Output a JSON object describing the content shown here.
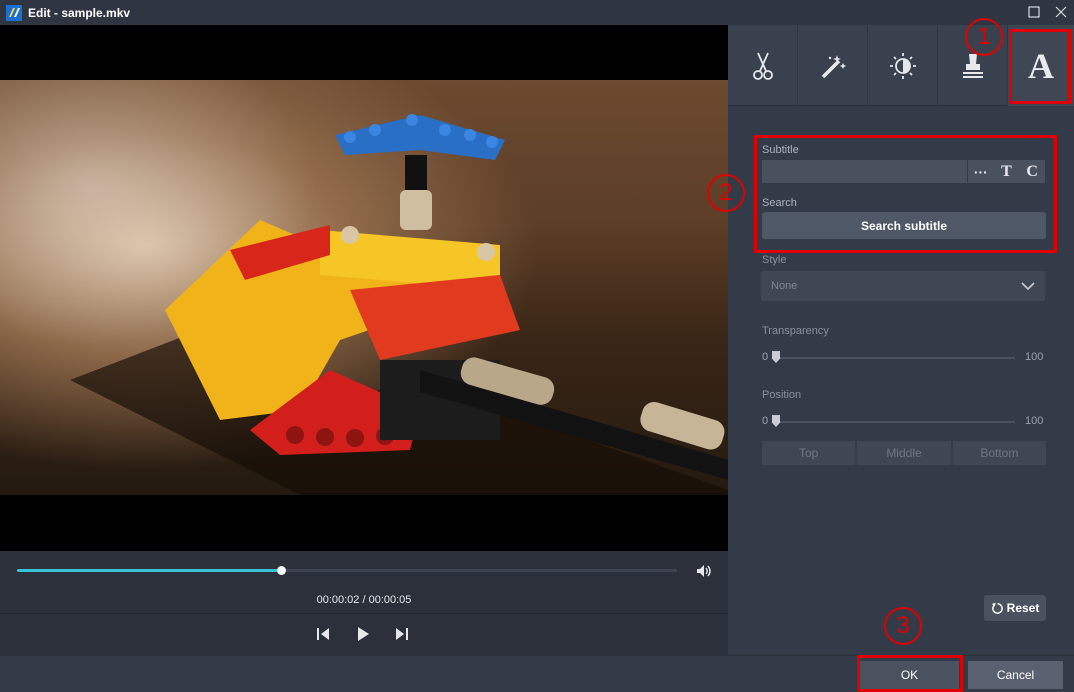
{
  "window": {
    "title": "Edit - sample.mkv"
  },
  "player": {
    "progress": 0.4,
    "time_readout": "00:00:02 / 00:00:05"
  },
  "tabs": [
    {
      "icon": "scissors-icon"
    },
    {
      "icon": "magic-wand-icon"
    },
    {
      "icon": "brightness-icon"
    },
    {
      "icon": "watermark-stamp-icon"
    },
    {
      "icon": "text-icon",
      "label": "A",
      "active": true
    }
  ],
  "subtitle": {
    "label": "Subtitle",
    "value": "",
    "tools": {
      "more": "···",
      "text": "T",
      "copyright": "C"
    }
  },
  "search": {
    "label": "Search",
    "button": "Search subtitle"
  },
  "style": {
    "label": "Style",
    "selected": "None"
  },
  "transparency": {
    "label": "Transparency",
    "min": "0",
    "max": "100",
    "value": 0
  },
  "position": {
    "label": "Position",
    "min": "0",
    "max": "100",
    "value": 0,
    "buttons": {
      "top": "Top",
      "middle": "Middle",
      "bottom": "Bottom"
    }
  },
  "reset": {
    "label": "Reset"
  },
  "footer": {
    "ok": "OK",
    "cancel": "Cancel"
  },
  "callouts": [
    "1",
    "2",
    "3"
  ],
  "colors": {
    "accent": "#38c2d6",
    "highlight": "#e00000",
    "panel": "#343b48"
  }
}
